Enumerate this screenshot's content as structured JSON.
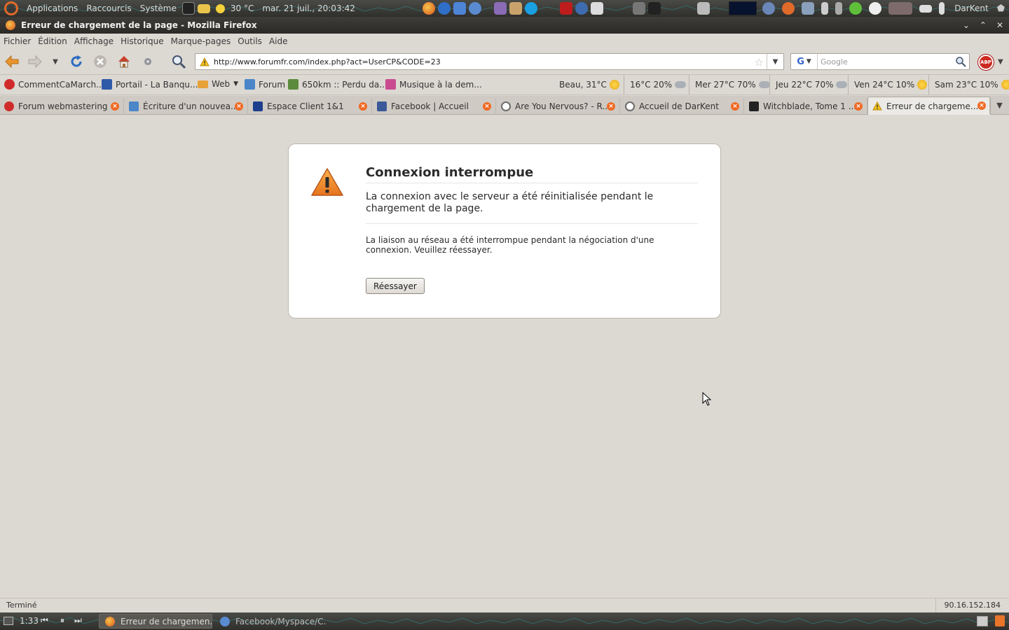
{
  "top_panel": {
    "menus": [
      "Applications",
      "Raccourcis",
      "Système"
    ],
    "weather": "30 °C",
    "datetime": "mar. 21 juil., 20:03:42",
    "user": "DarKent",
    "icons": [
      "ubuntu-logo-icon",
      "terminal-icon",
      "folder-icon",
      "sun-icon",
      "firefox-icon",
      "ie-icon",
      "thunderbird-icon",
      "pidgin-icon",
      "skype-icon",
      "filezilla-icon",
      "network-icon",
      "mail-icon",
      "volume-icon"
    ]
  },
  "window": {
    "title": "Erreur de chargement de la page - Mozilla Firefox",
    "controls": [
      "minimize",
      "maximize",
      "close"
    ]
  },
  "menubar": [
    "Fichier",
    "Édition",
    "Affichage",
    "Historique",
    "Marque-pages",
    "Outils",
    "Aide"
  ],
  "navbar": {
    "url": "http://www.forumfr.com/index.php?act=UserCP&CODE=23",
    "search_placeholder": "Google",
    "search_engine": "G",
    "abp_label": "ABP"
  },
  "bookmarks": [
    {
      "label": "CommentCaMarch...",
      "color": "#d02b2b"
    },
    {
      "label": "Portail - La Banqu...",
      "color": "#2e5aa8"
    },
    {
      "label": "Web",
      "color": "#e8a23a"
    },
    {
      "label": "Forum",
      "color": "#4a86c8"
    },
    {
      "label": "650km :: Perdu da...",
      "color": "#5d8a3c"
    },
    {
      "label": "Musique à la dem...",
      "color": "#c94b8f"
    }
  ],
  "weather_bar": [
    {
      "label": "Beau, 31°C",
      "icon": "sun"
    },
    {
      "label": "16°C 20%",
      "icon": "cloud"
    },
    {
      "label": "Mer 27°C 70%",
      "icon": "cloud"
    },
    {
      "label": "Jeu 22°C 70%",
      "icon": "cloud"
    },
    {
      "label": "Ven 24°C 10%",
      "icon": "sun"
    },
    {
      "label": "Sam 23°C 10%",
      "icon": "sun"
    }
  ],
  "tabs": [
    {
      "label": "Forum webmastering",
      "color": "#d02b2b",
      "active": false
    },
    {
      "label": "Écriture d'un nouvea...",
      "color": "#4a86c8",
      "active": false
    },
    {
      "label": "Espace Client 1&1",
      "color": "#1c3e8c",
      "active": false
    },
    {
      "label": "Facebook | Accueil",
      "color": "#3b5998",
      "active": false
    },
    {
      "label": "Are You Nervous? - R...",
      "color": "#6c6c6c",
      "active": false
    },
    {
      "label": "Accueil de DarKent",
      "color": "#6c6c6c",
      "active": false
    },
    {
      "label": "Witchblade, Tome 1 ...",
      "color": "#222222",
      "active": false
    },
    {
      "label": "Erreur de chargeme...",
      "color": "#f0b400",
      "active": true
    }
  ],
  "error_page": {
    "title": "Connexion interrompue",
    "short_desc": "La connexion avec le serveur a été réinitialisée pendant le chargement de la page.",
    "long_desc": "La liaison au réseau a été interrompue pendant la négociation d'une connexion. Veuillez réessayer.",
    "retry_label": "Réessayer"
  },
  "statusbar": {
    "status": "Terminé",
    "ip": "90.16.152.184"
  },
  "bottom_panel": {
    "time": "1:33",
    "tasks": [
      {
        "label": "Erreur de chargemen...",
        "active": true
      },
      {
        "label": "Facebook/Myspace/C...",
        "active": false
      }
    ]
  },
  "colors": {
    "panel": "#3a3a3a",
    "chrome": "#dcd8d2",
    "warning": "#f08a24",
    "close_badge": "#ef6a25"
  }
}
